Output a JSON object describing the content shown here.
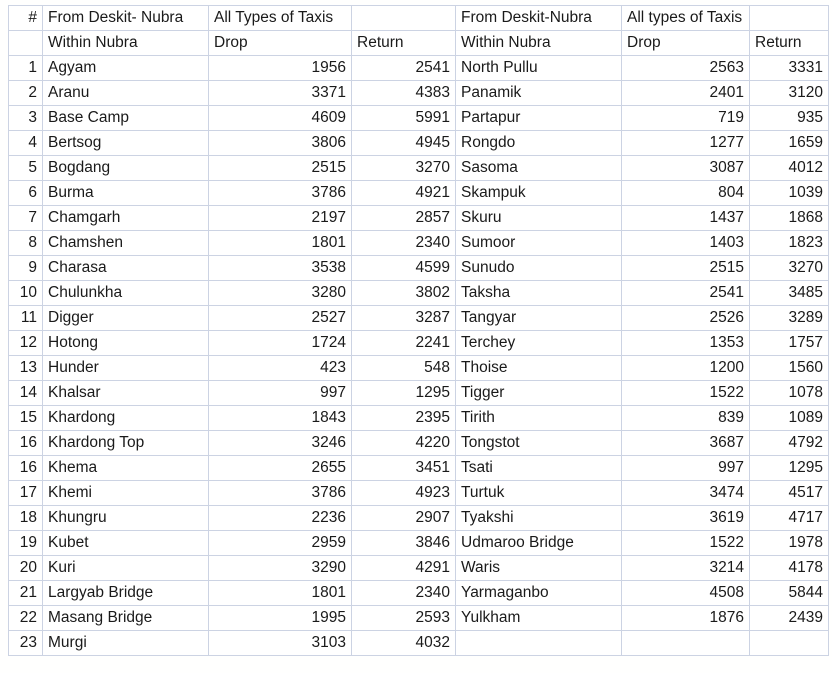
{
  "table": {
    "header_top": {
      "index": "#",
      "left_group": "From Deskit- Nubra",
      "left_taxis": "All Types of Taxis",
      "left_spacer": "",
      "right_group": "From Deskit-Nubra",
      "right_taxis": "All types of Taxis",
      "right_spacer": ""
    },
    "header_sub": {
      "index": "",
      "left_within": "Within Nubra",
      "left_drop": "Drop",
      "left_return": "Return",
      "right_within": "Within Nubra",
      "right_drop": "Drop",
      "right_return": "Return"
    },
    "rows": [
      {
        "idx": "1",
        "left_name": "Agyam",
        "left_drop": "1956",
        "left_return": "2541",
        "right_name": "North Pullu",
        "right_drop": "2563",
        "right_return": "3331"
      },
      {
        "idx": "2",
        "left_name": "Aranu",
        "left_drop": "3371",
        "left_return": "4383",
        "right_name": "Panamik",
        "right_drop": "2401",
        "right_return": "3120"
      },
      {
        "idx": "3",
        "left_name": "Base Camp",
        "left_drop": "4609",
        "left_return": "5991",
        "right_name": "Partapur",
        "right_drop": "719",
        "right_return": "935"
      },
      {
        "idx": "4",
        "left_name": "Bertsog",
        "left_drop": "3806",
        "left_return": "4945",
        "right_name": "Rongdo",
        "right_drop": "1277",
        "right_return": "1659"
      },
      {
        "idx": "5",
        "left_name": "Bogdang",
        "left_drop": "2515",
        "left_return": "3270",
        "right_name": "Sasoma",
        "right_drop": "3087",
        "right_return": "4012"
      },
      {
        "idx": "6",
        "left_name": "Burma",
        "left_drop": "3786",
        "left_return": "4921",
        "right_name": "Skampuk",
        "right_drop": "804",
        "right_return": "1039"
      },
      {
        "idx": "7",
        "left_name": "Chamgarh",
        "left_drop": "2197",
        "left_return": "2857",
        "right_name": "Skuru",
        "right_drop": "1437",
        "right_return": "1868"
      },
      {
        "idx": "8",
        "left_name": "Chamshen",
        "left_drop": "1801",
        "left_return": "2340",
        "right_name": "Sumoor",
        "right_drop": "1403",
        "right_return": "1823"
      },
      {
        "idx": "9",
        "left_name": "Charasa",
        "left_drop": "3538",
        "left_return": "4599",
        "right_name": "Sunudo",
        "right_drop": "2515",
        "right_return": "3270"
      },
      {
        "idx": "10",
        "left_name": "Chulunkha",
        "left_drop": "3280",
        "left_return": "3802",
        "right_name": "Taksha",
        "right_drop": "2541",
        "right_return": "3485"
      },
      {
        "idx": "11",
        "left_name": "Digger",
        "left_drop": "2527",
        "left_return": "3287",
        "right_name": "Tangyar",
        "right_drop": "2526",
        "right_return": "3289"
      },
      {
        "idx": "12",
        "left_name": "Hotong",
        "left_drop": "1724",
        "left_return": "2241",
        "right_name": "Terchey",
        "right_drop": "1353",
        "right_return": "1757"
      },
      {
        "idx": "13",
        "left_name": "Hunder",
        "left_drop": "423",
        "left_return": "548",
        "right_name": "Thoise",
        "right_drop": "1200",
        "right_return": "1560"
      },
      {
        "idx": "14",
        "left_name": "Khalsar",
        "left_drop": "997",
        "left_return": "1295",
        "right_name": "Tigger",
        "right_drop": "1522",
        "right_return": "1078"
      },
      {
        "idx": "15",
        "left_name": "Khardong",
        "left_drop": "1843",
        "left_return": "2395",
        "right_name": "Tirith",
        "right_drop": "839",
        "right_return": "1089"
      },
      {
        "idx": "16",
        "left_name": "Khardong Top",
        "left_drop": "3246",
        "left_return": "4220",
        "right_name": "Tongstot",
        "right_drop": "3687",
        "right_return": "4792"
      },
      {
        "idx": "16",
        "left_name": "Khema",
        "left_drop": "2655",
        "left_return": "3451",
        "right_name": "Tsati",
        "right_drop": "997",
        "right_return": "1295"
      },
      {
        "idx": "17",
        "left_name": "Khemi",
        "left_drop": "3786",
        "left_return": "4923",
        "right_name": "Turtuk",
        "right_drop": "3474",
        "right_return": "4517"
      },
      {
        "idx": "18",
        "left_name": "Khungru",
        "left_drop": "2236",
        "left_return": "2907",
        "right_name": "Tyakshi",
        "right_drop": "3619",
        "right_return": "4717"
      },
      {
        "idx": "19",
        "left_name": "Kubet",
        "left_drop": "2959",
        "left_return": "3846",
        "right_name": "Udmaroo Bridge",
        "right_drop": "1522",
        "right_return": "1978"
      },
      {
        "idx": "20",
        "left_name": "Kuri",
        "left_drop": "3290",
        "left_return": "4291",
        "right_name": "Waris",
        "right_drop": "3214",
        "right_return": "4178"
      },
      {
        "idx": "21",
        "left_name": "Largyab Bridge",
        "left_drop": "1801",
        "left_return": "2340",
        "right_name": "Yarmaganbo",
        "right_drop": "4508",
        "right_return": "5844"
      },
      {
        "idx": "22",
        "left_name": "Masang Bridge",
        "left_drop": "1995",
        "left_return": "2593",
        "right_name": "Yulkham",
        "right_drop": "1876",
        "right_return": "2439"
      },
      {
        "idx": "23",
        "left_name": "Murgi",
        "left_drop": "3103",
        "left_return": "4032",
        "right_name": "",
        "right_drop": "",
        "right_return": ""
      }
    ]
  },
  "colors": {
    "gridline": "#ccd3e3",
    "text": "#1a1a1a",
    "background": "#ffffff"
  }
}
